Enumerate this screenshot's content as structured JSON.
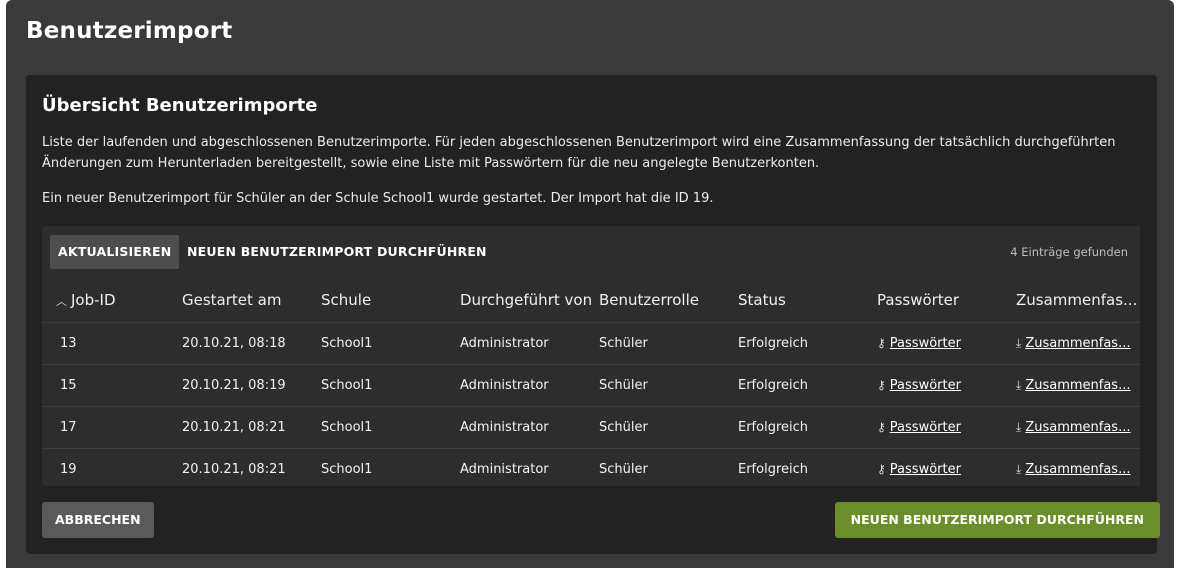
{
  "window": {
    "title": "Benutzerimport"
  },
  "card": {
    "title": "Übersicht Benutzerimporte",
    "description": "Liste der laufenden und abgeschlossenen Benutzerimporte. Für jeden abgeschlossenen Benutzerimport wird eine Zusammenfassung der tatsächlich durchgeführten Änderungen zum Herunterladen bereitgestellt, sowie eine Liste mit Passwörtern für die neu angelegte Benutzerkonten.",
    "status_message": "Ein neuer Benutzerimport für Schüler an der Schule School1 wurde gestartet. Der Import hat die ID 19."
  },
  "toolbar": {
    "refresh_label": "AKTUALISIEREN",
    "new_import_label": "NEUEN BENUTZERIMPORT DURCHFÜHREN",
    "count_text": "4 Einträge gefunden"
  },
  "table": {
    "sort_icon": "chevron-up-icon",
    "columns": [
      "Job-ID",
      "Gestartet am",
      "Schule",
      "Durchgeführt von",
      "Benutzerrolle",
      "Status",
      "Passwörter",
      "Zusammenfas..."
    ],
    "rows": [
      [
        "13",
        "20.10.21, 08:18",
        "School1",
        "Administrator",
        "Schüler",
        "Erfolgreich",
        "Passwörter",
        "Zusammenfas..."
      ],
      [
        "15",
        "20.10.21, 08:19",
        "School1",
        "Administrator",
        "Schüler",
        "Erfolgreich",
        "Passwörter",
        "Zusammenfas..."
      ],
      [
        "17",
        "20.10.21, 08:21",
        "School1",
        "Administrator",
        "Schüler",
        "Erfolgreich",
        "Passwörter",
        "Zusammenfas..."
      ],
      [
        "19",
        "20.10.21, 08:21",
        "School1",
        "Administrator",
        "Schüler",
        "Erfolgreich",
        "Passwörter",
        "Zusammenfas..."
      ]
    ],
    "password_icon": "key-icon",
    "summary_icon": "download-icon"
  },
  "footer": {
    "cancel_label": "ABBRECHEN",
    "primary_label": "NEUEN BENUTZERIMPORT DURCHFÜHREN",
    "primary_color": "#6a8f2a"
  }
}
